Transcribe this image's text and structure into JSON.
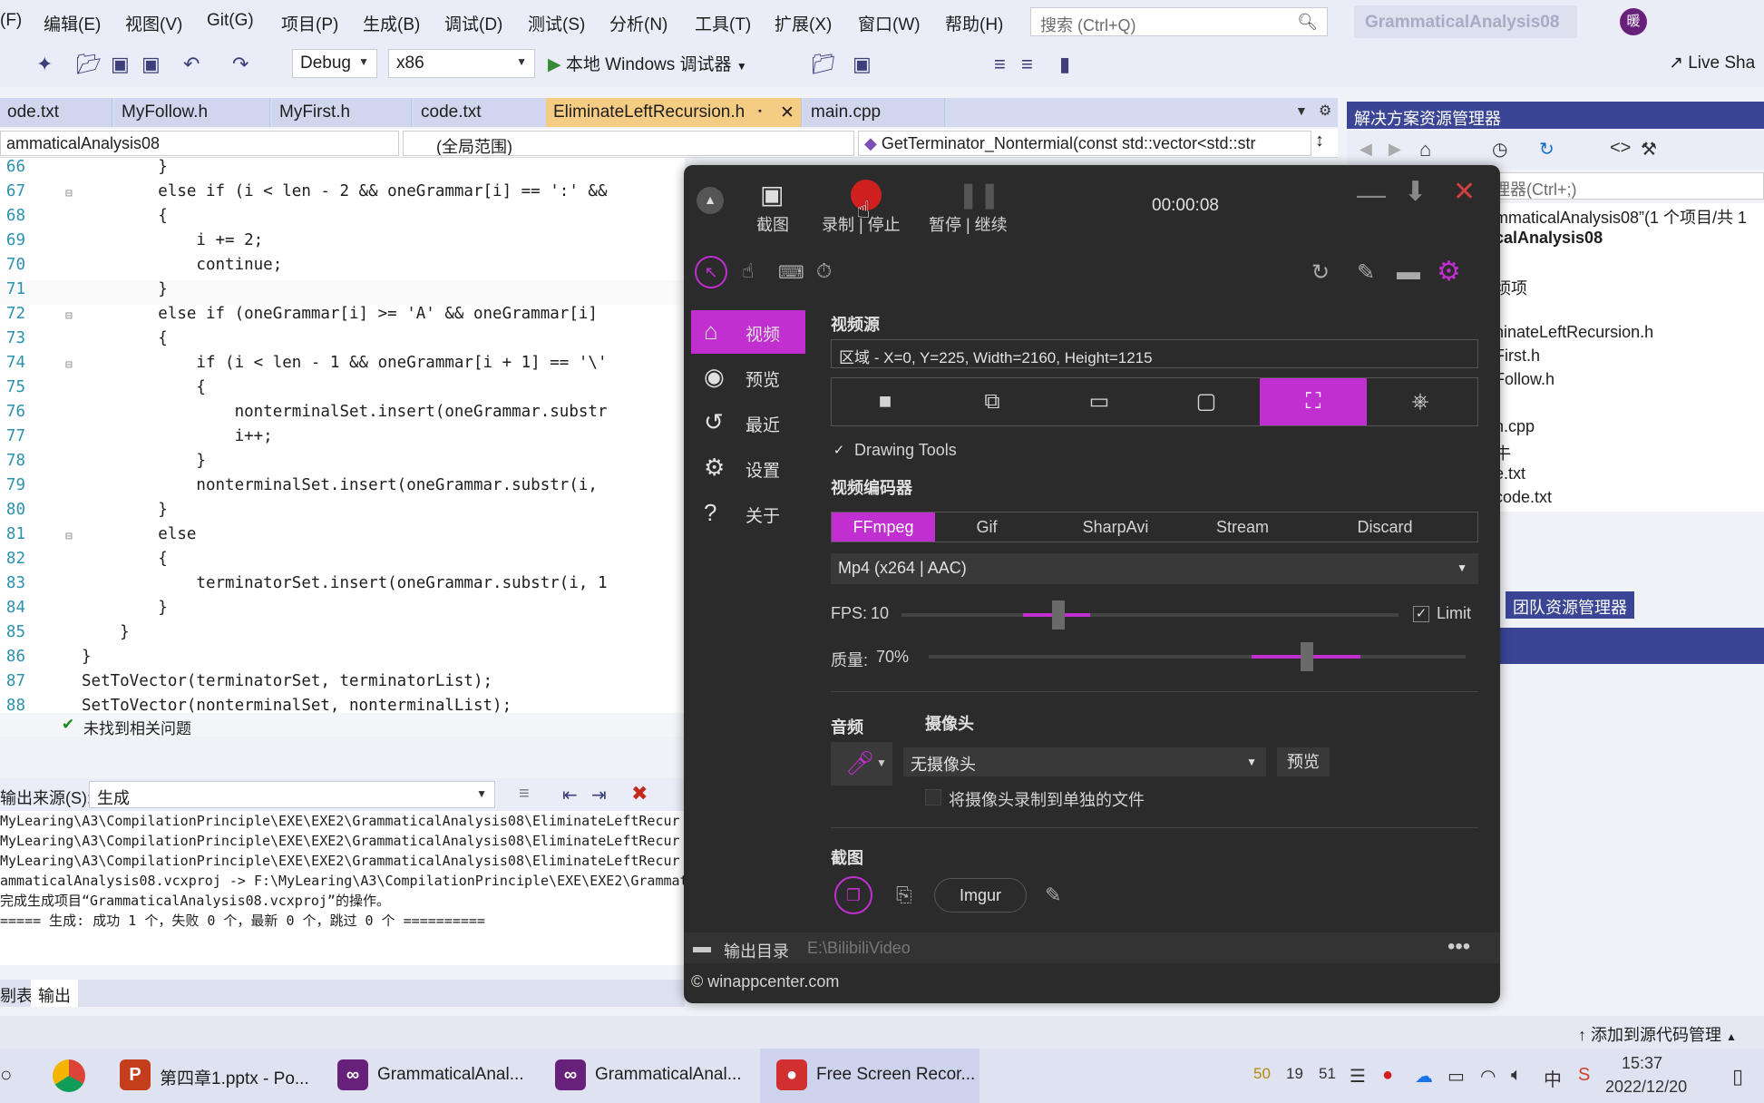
{
  "menu": [
    "(F)",
    "编辑(E)",
    "视图(V)",
    "Git(G)",
    "项目(P)",
    "生成(B)",
    "调试(D)",
    "测试(S)",
    "分析(N)",
    "工具(T)",
    "扩展(X)",
    "窗口(W)",
    "帮助(H)"
  ],
  "search_placeholder": "搜索 (Ctrl+Q)",
  "solution_title": "GrammaticalAnalysis08",
  "avatar_letter": "暖",
  "toolbar": {
    "config": "Debug",
    "platform": "x86",
    "run_label": "本地 Windows 调试器",
    "liveshare": "Live Sha"
  },
  "tabs": [
    "ode.txt",
    "MyFollow.h",
    "MyFirst.h",
    "code.txt",
    "EliminateLeftRecursion.h",
    "main.cpp"
  ],
  "nav": {
    "project": "ammaticalAnalysis08",
    "scope": "(全局范围)",
    "member": "GetTerminator_Nontermial(const std::vector<std::str"
  },
  "code_lines": [
    {
      "n": "66",
      "t": "        }"
    },
    {
      "n": "67",
      "t": "        else if (i < len - 2 && oneGrammar[i] == ':' &&"
    },
    {
      "n": "68",
      "t": "        {"
    },
    {
      "n": "69",
      "t": "            i += 2;"
    },
    {
      "n": "70",
      "t": "            continue;"
    },
    {
      "n": "71",
      "t": "        }"
    },
    {
      "n": "72",
      "t": "        else if (oneGrammar[i] >= 'A' && oneGrammar[i]"
    },
    {
      "n": "73",
      "t": "        {"
    },
    {
      "n": "74",
      "t": "            if (i < len - 1 && oneGrammar[i + 1] == '\\'"
    },
    {
      "n": "75",
      "t": "            {"
    },
    {
      "n": "76",
      "t": "                nonterminalSet.insert(oneGrammar.substr"
    },
    {
      "n": "77",
      "t": "                i++;"
    },
    {
      "n": "78",
      "t": "            }"
    },
    {
      "n": "79",
      "t": "            nonterminalSet.insert(oneGrammar.substr(i,"
    },
    {
      "n": "80",
      "t": "        }"
    },
    {
      "n": "81",
      "t": "        else"
    },
    {
      "n": "82",
      "t": "        {"
    },
    {
      "n": "83",
      "t": "            terminatorSet.insert(oneGrammar.substr(i, 1"
    },
    {
      "n": "84",
      "t": "        }"
    },
    {
      "n": "85",
      "t": "    }"
    },
    {
      "n": "86",
      "t": "}"
    },
    {
      "n": "87",
      "t": "SetToVector(terminatorSet, terminatorList);"
    },
    {
      "n": "88",
      "t": "SetToVector(nonterminalSet, nonterminalList);"
    }
  ],
  "editor_status": "未找到相关问题",
  "output": {
    "source_label": "输出来源(S):",
    "source_value": "生成",
    "lines": [
      "MyLearing\\A3\\CompilationPrinciple\\EXE\\EXE2\\GrammaticalAnalysis08\\EliminateLeftRecur",
      "MyLearing\\A3\\CompilationPrinciple\\EXE\\EXE2\\GrammaticalAnalysis08\\EliminateLeftRecur",
      "MyLearing\\A3\\CompilationPrinciple\\EXE\\EXE2\\GrammaticalAnalysis08\\EliminateLeftRecur",
      "ammaticalAnalysis08.vcxproj -> F:\\MyLearing\\A3\\CompilationPrinciple\\EXE\\EXE2\\Grammat",
      "完成生成项目“GrammaticalAnalysis08.vcxproj”的操作。",
      "===== 生成: 成功 1 个，失败 0 个，最新 0 个，跳过 0 个 =========="
    ]
  },
  "bottom_tabs": [
    "剔表",
    "输出"
  ],
  "status_right": "添加到源代码管理",
  "solution_explorer": {
    "title": "解决方案资源管理器",
    "search": "理器(Ctrl+;)",
    "items": [
      "mmaticalAnalysis08”(1 个项目/共 1",
      "calAnalysis08",
      "顷项",
      "ninateLeftRecursion.h",
      "First.h",
      "Follow.h",
      "n.cpp",
      "牛",
      "e.txt",
      "code.txt"
    ],
    "team_tab": "团队资源管理器"
  },
  "recorder": {
    "timer": "00:00:08",
    "top_buttons": [
      "截图",
      "录制 | 停止",
      "暂停 | 继续"
    ],
    "nav": [
      "视频",
      "预览",
      "最近",
      "设置",
      "关于"
    ],
    "video_source_title": "视频源",
    "video_source_value": "区域 - X=0, Y=225, Width=2160, Height=1215",
    "drawing_tools": "Drawing Tools",
    "encoder_title": "视频编码器",
    "encoders": [
      "FFmpeg",
      "Gif",
      "SharpAvi",
      "Stream",
      "Discard"
    ],
    "format": "Mp4 (x264 | AAC)",
    "fps_label": "FPS:",
    "fps_value": "10",
    "limit": "Limit",
    "quality_label": "质量:",
    "quality_value": "70%",
    "audio_title": "音频",
    "camera_title": "摄像头",
    "camera_value": "无摄像头",
    "camera_preview": "预览",
    "camera_separate": "将摄像头录制到单独的文件",
    "screenshot_title": "截图",
    "imgur": "Imgur",
    "output_label": "输出目录",
    "output_path": "E:\\BilibiliVideo",
    "copyright": "© winappcenter.com"
  },
  "taskbar": {
    "tasks": [
      "第四章1.pptx - Po...",
      "GrammaticalAnal...",
      "GrammaticalAnal...",
      "Free Screen Recor..."
    ],
    "tray_nums": [
      "50",
      "19",
      "51"
    ],
    "ime": "中",
    "time": "15:37",
    "date": "2022/12/20"
  },
  "colors": {
    "accent": "#c22fd1",
    "vs_blue": "#3a4595",
    "tab_active": "#f5cc84"
  }
}
